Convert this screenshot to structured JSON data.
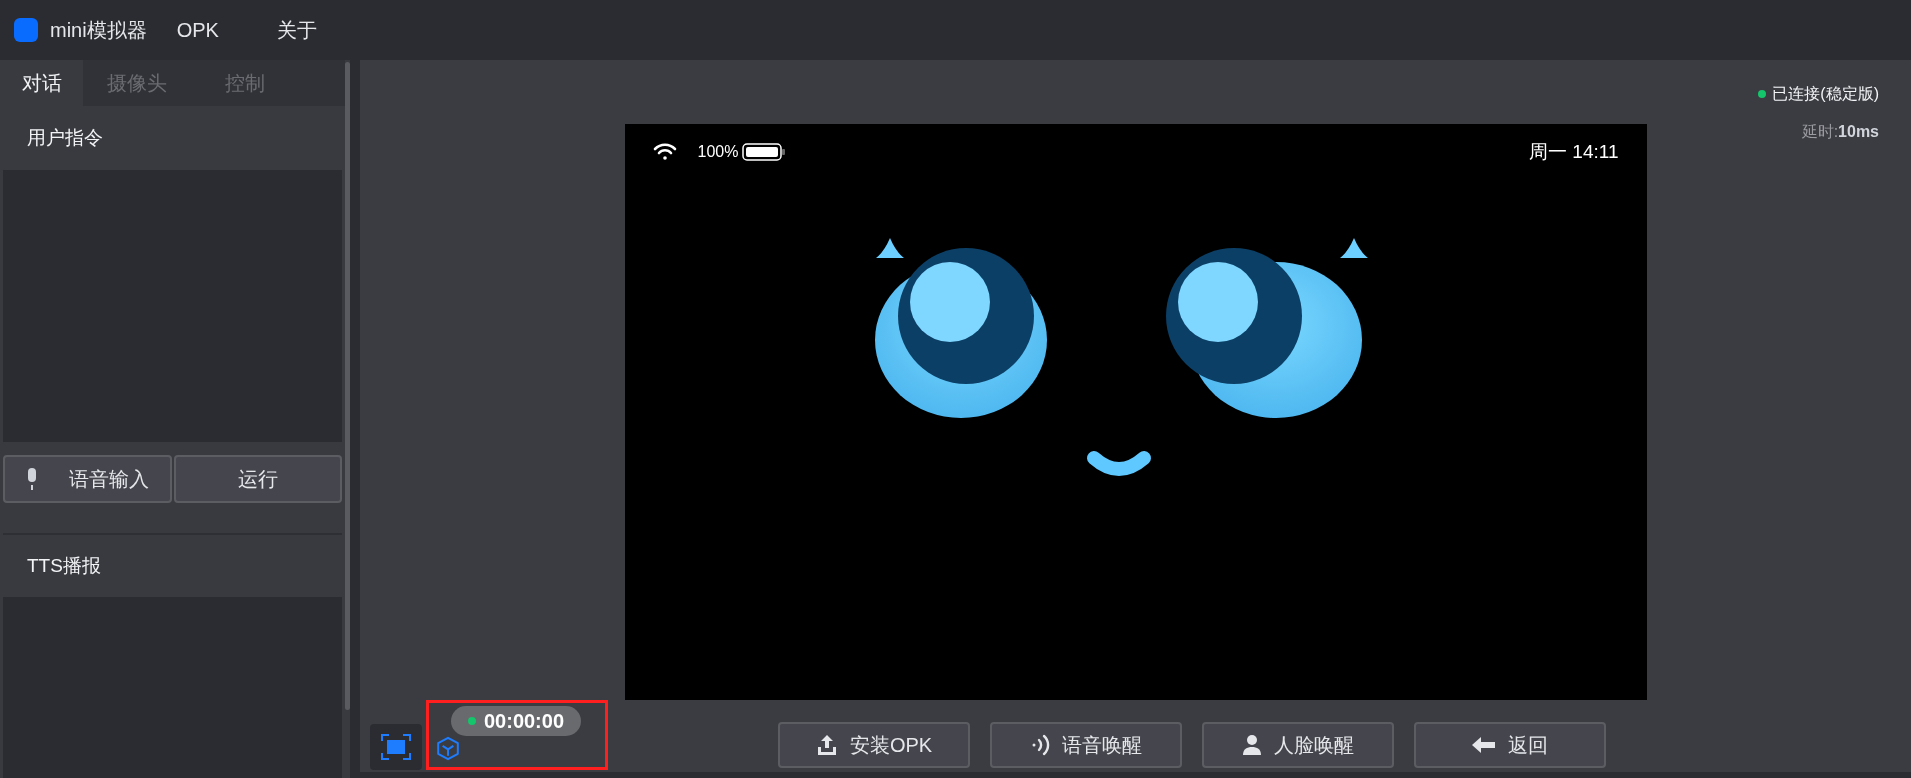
{
  "app": {
    "title": "mini模拟器",
    "menu": [
      {
        "label": "OPK"
      },
      {
        "label": "关于"
      }
    ]
  },
  "tabs": [
    {
      "label": "对话",
      "selected": true
    },
    {
      "label": "摄像头",
      "selected": false
    },
    {
      "label": "控制",
      "selected": false
    }
  ],
  "command_section": {
    "title": "用户指令",
    "buttons": [
      {
        "label": "语音输入",
        "kind": "mic"
      },
      {
        "label": "运行",
        "kind": "plain"
      }
    ]
  },
  "tts_section": {
    "title": "TTS播报"
  },
  "connection": {
    "status": "已连接(稳定版)",
    "latency_label": "延时:",
    "latency_value": "10ms"
  },
  "device_status_bar": {
    "battery": "100%",
    "clock": "周一 14:11"
  },
  "timer": "00:00:00",
  "actions": [
    {
      "label": "安装OPK",
      "kind": "upload"
    },
    {
      "label": "语音唤醒",
      "kind": "voice"
    },
    {
      "label": "人脸唤醒",
      "kind": "person"
    },
    {
      "label": "返回",
      "kind": "back"
    }
  ]
}
